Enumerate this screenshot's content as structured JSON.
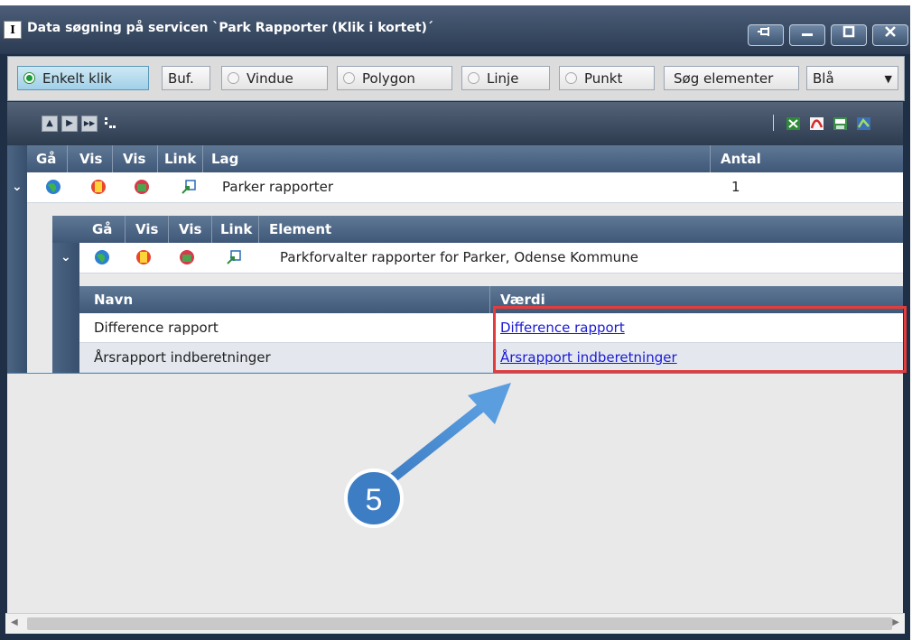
{
  "window": {
    "title": "Data søgning på servicen `Park Rapporter (Klik i kortet)´",
    "title_icon_letter": "I"
  },
  "toolbar": {
    "enkelt_klik": "Enkelt klik",
    "buf": "Buf.",
    "vindue": "Vindue",
    "polygon": "Polygon",
    "linje": "Linje",
    "punkt": "Punkt",
    "sog_elementer": "Søg elementer",
    "color_select": "Blå"
  },
  "layer_table": {
    "columns": [
      "Gå",
      "Vis",
      "Vis",
      "Link",
      "Lag",
      "Antal"
    ],
    "rows": [
      {
        "lag": "Parker rapporter",
        "antal": "1"
      }
    ]
  },
  "element_table": {
    "columns": [
      "Gå",
      "Vis",
      "Vis",
      "Link",
      "Element"
    ],
    "rows": [
      {
        "element": "Parkforvalter rapporter for Parker, Odense Kommune"
      }
    ]
  },
  "attribute_table": {
    "columns": [
      "Navn",
      "Værdi"
    ],
    "rows": [
      {
        "navn": "Difference rapport",
        "vaerdi": "Difference rapport"
      },
      {
        "navn": "Årsrapport indberetninger",
        "vaerdi": "Årsrapport indberetninger"
      }
    ]
  },
  "annotation": {
    "step_number": "5"
  },
  "colors": {
    "accent": "#3d8fd4",
    "highlight": "#e23c3c",
    "header": "#4e6786"
  }
}
